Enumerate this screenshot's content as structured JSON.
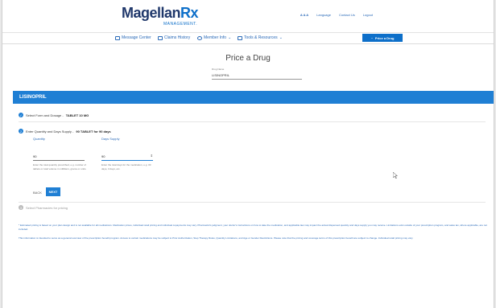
{
  "header": {
    "logo_main": "Magellan",
    "logo_rx": "Rx",
    "logo_sub": "MANAGEMENT.",
    "font_size_label": "A A A",
    "language": "Language",
    "contact": "Contact Us",
    "logout": "Logout"
  },
  "nav": {
    "items": [
      {
        "label": "Message Center",
        "icon": "envelope-icon"
      },
      {
        "label": "Claims History",
        "icon": "document-icon"
      },
      {
        "label": "Member Info",
        "icon": "person-icon"
      },
      {
        "label": "Tools & Resources",
        "icon": "tools-icon"
      }
    ],
    "price_drug_button": "Price a Drug"
  },
  "page": {
    "title": "Price a Drug",
    "drug_name_label": "Drug Name",
    "drug_name_value": "LISINOPRIL"
  },
  "drug_bar": {
    "label": "LISINOPRIL"
  },
  "step1": {
    "prefix": "Select Form and Dosage - ",
    "value": "TABLET 10 MG"
  },
  "step2": {
    "number": "2",
    "prefix": "Enter Quantity and Days Supply - ",
    "value": "90 TABLET for 90 days",
    "quantity_label": "Quantity",
    "days_label": "Days Supply",
    "quantity_value": "90",
    "days_value": "90",
    "quantity_help": "Enter the total quantity prescribed, e.g. number of tablets or total volume in milliliters, grams or units.",
    "days_help": "Enter the total days for the medication, e.g. 30 days, 3 days, etc.",
    "back_label": "BACK",
    "next_label": "NEXT"
  },
  "step3": {
    "number": "3",
    "label": "Select Pharmacies for pricing"
  },
  "disclaimer": {
    "p1": "* Estimated pricing is based on your plan design and is not available for all medications. Medication prices, individual retail pricing and individual copayments may vary. Pharmacist's judgment, your doctor's instructions on how to take the medication, and applicable law may impact the actual dispensed quantity and days supply you may receive. Limitations exist outside of your prescription program, and sales tax, where applicable, are not included.",
    "p2": "This information is intended to serve as a general overview of the prescription benefit program. Access to certain medications may be subject to Prior Authorization, Step Therapy Rules, Quantity Limitations, and Age or Gender Restrictions. Please note that the pricing and coverage terms of this prescription benefit are subject to change. Individual retail pricing may vary."
  },
  "colors": {
    "primary": "#1f7fd4",
    "navy": "#20386b"
  }
}
